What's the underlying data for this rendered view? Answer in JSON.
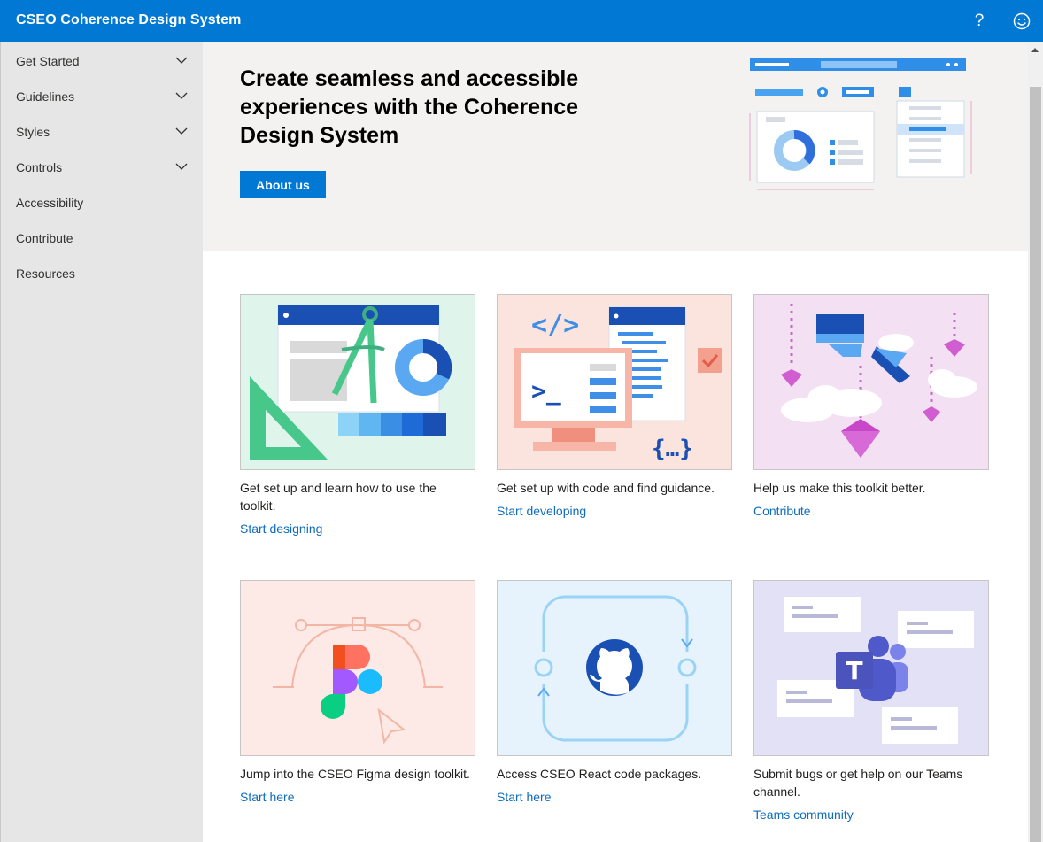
{
  "header": {
    "title": "CSEO Coherence Design System",
    "help_label": "?"
  },
  "sidebar": {
    "items": [
      {
        "label": "Get Started",
        "expandable": true
      },
      {
        "label": "Guidelines",
        "expandable": true
      },
      {
        "label": "Styles",
        "expandable": true
      },
      {
        "label": "Controls",
        "expandable": true
      },
      {
        "label": "Accessibility",
        "expandable": false
      },
      {
        "label": "Contribute",
        "expandable": false
      },
      {
        "label": "Resources",
        "expandable": false
      }
    ]
  },
  "hero": {
    "title": "Create seamless and accessible experiences with the Coherence Design System",
    "button_label": "About us"
  },
  "cards": [
    {
      "description": "Get set up and learn how to use the toolkit.",
      "link": "Start designing",
      "icon": "design-tools-illustration"
    },
    {
      "description": "Get set up with code and find guidance.",
      "link": "Start developing",
      "icon": "code-illustration"
    },
    {
      "description": "Help us make this toolkit better.",
      "link": "Contribute",
      "icon": "contribute-illustration"
    },
    {
      "description": "Jump into the CSEO Figma design toolkit.",
      "link": "Start here",
      "icon": "figma-illustration"
    },
    {
      "description": "Access CSEO React code packages.",
      "link": "Start here",
      "icon": "github-illustration"
    },
    {
      "description": "Submit bugs or get help on our Teams channel.",
      "link": "Teams community",
      "icon": "teams-illustration"
    }
  ],
  "colors": {
    "accent": "#0078d4",
    "link": "#0f6cbd",
    "sidebar_bg": "#e6e6e6",
    "hero_bg": "#f3f2f1"
  }
}
